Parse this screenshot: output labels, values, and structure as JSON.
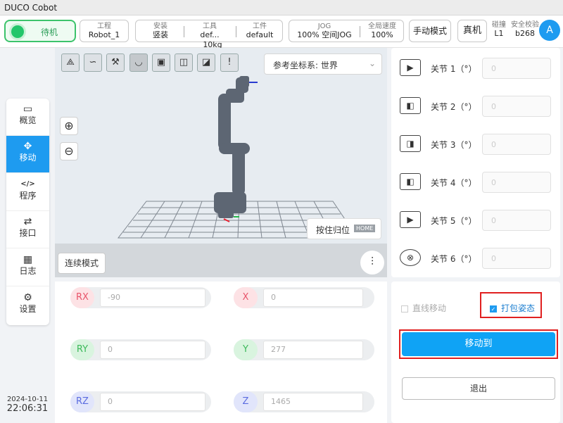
{
  "app": {
    "title": "DUCO Cobot"
  },
  "topbar": {
    "status": "待机",
    "project": {
      "label": "工程",
      "value": "Robot_1"
    },
    "install": {
      "label": "安装",
      "value": "竖装"
    },
    "tool": {
      "label": "工具",
      "name": "def...",
      "weight": "10kg"
    },
    "workpiece": {
      "label": "工件",
      "value": "default"
    },
    "jog": {
      "label": "JOG",
      "percent": "100%",
      "mode": "空间JOG"
    },
    "speed": {
      "label": "全局速度",
      "value": "100%"
    },
    "manual_mode": "手动模式",
    "real_machine": "真机",
    "collision": {
      "label": "碰撞",
      "value": "L1"
    },
    "safety": {
      "label": "安全校验",
      "value": "b268"
    },
    "avatar": "A"
  },
  "sidebar": {
    "items": [
      {
        "label": "概览",
        "icon": "monitor-icon"
      },
      {
        "label": "移动",
        "icon": "move-icon"
      },
      {
        "label": "程序",
        "icon": "code-icon"
      },
      {
        "label": "接口",
        "icon": "swap-icon"
      },
      {
        "label": "日志",
        "icon": "calendar-icon"
      },
      {
        "label": "设置",
        "icon": "gear-icon"
      }
    ],
    "date": "2024-10-11",
    "time": "22:06:31"
  },
  "viewport": {
    "coord_system": "参考坐标系: 世界",
    "home_button": "按住归位",
    "home_tag": "HOME",
    "continuous_mode": "连续模式"
  },
  "coords": {
    "RX": "-90",
    "X": "0",
    "RY": "0",
    "Y": "277",
    "RZ": "0",
    "Z": "1465",
    "colors": {
      "rx": "#e8546a",
      "ry": "#3cb95a",
      "rz": "#5b6ce0"
    }
  },
  "joints": [
    {
      "label": "关节 1（°）",
      "value": "0"
    },
    {
      "label": "关节 2（°）",
      "value": "0"
    },
    {
      "label": "关节 3（°）",
      "value": "0"
    },
    {
      "label": "关节 4（°）",
      "value": "0"
    },
    {
      "label": "关节 5（°）",
      "value": "0"
    },
    {
      "label": "关节 6（°）",
      "value": "0"
    }
  ],
  "actions": {
    "linear_move": "直线移动",
    "pack_pose": "打包姿态",
    "move_to": "移动到",
    "exit": "退出"
  }
}
